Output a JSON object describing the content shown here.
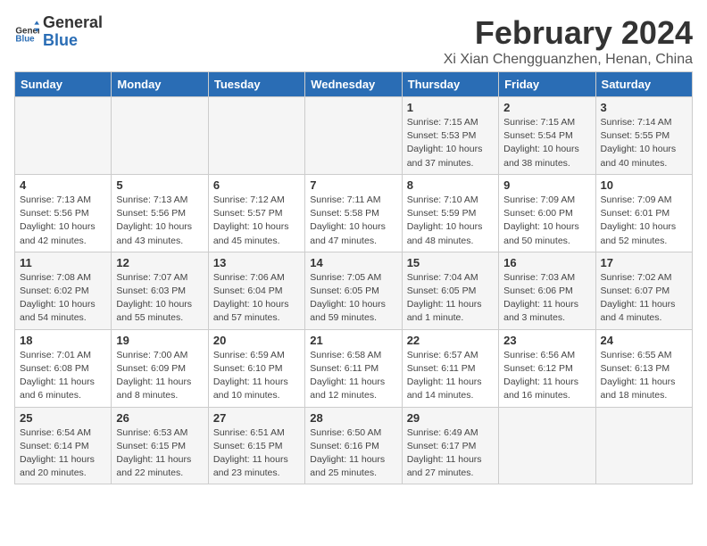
{
  "logo": {
    "name_part1": "General",
    "name_part2": "Blue"
  },
  "title": "February 2024",
  "subtitle": "Xi Xian Chengguanzhen, Henan, China",
  "days_of_week": [
    "Sunday",
    "Monday",
    "Tuesday",
    "Wednesday",
    "Thursday",
    "Friday",
    "Saturday"
  ],
  "weeks": [
    [
      {
        "day": "",
        "info": ""
      },
      {
        "day": "",
        "info": ""
      },
      {
        "day": "",
        "info": ""
      },
      {
        "day": "",
        "info": ""
      },
      {
        "day": "1",
        "info": "Sunrise: 7:15 AM\nSunset: 5:53 PM\nDaylight: 10 hours\nand 37 minutes."
      },
      {
        "day": "2",
        "info": "Sunrise: 7:15 AM\nSunset: 5:54 PM\nDaylight: 10 hours\nand 38 minutes."
      },
      {
        "day": "3",
        "info": "Sunrise: 7:14 AM\nSunset: 5:55 PM\nDaylight: 10 hours\nand 40 minutes."
      }
    ],
    [
      {
        "day": "4",
        "info": "Sunrise: 7:13 AM\nSunset: 5:56 PM\nDaylight: 10 hours\nand 42 minutes."
      },
      {
        "day": "5",
        "info": "Sunrise: 7:13 AM\nSunset: 5:56 PM\nDaylight: 10 hours\nand 43 minutes."
      },
      {
        "day": "6",
        "info": "Sunrise: 7:12 AM\nSunset: 5:57 PM\nDaylight: 10 hours\nand 45 minutes."
      },
      {
        "day": "7",
        "info": "Sunrise: 7:11 AM\nSunset: 5:58 PM\nDaylight: 10 hours\nand 47 minutes."
      },
      {
        "day": "8",
        "info": "Sunrise: 7:10 AM\nSunset: 5:59 PM\nDaylight: 10 hours\nand 48 minutes."
      },
      {
        "day": "9",
        "info": "Sunrise: 7:09 AM\nSunset: 6:00 PM\nDaylight: 10 hours\nand 50 minutes."
      },
      {
        "day": "10",
        "info": "Sunrise: 7:09 AM\nSunset: 6:01 PM\nDaylight: 10 hours\nand 52 minutes."
      }
    ],
    [
      {
        "day": "11",
        "info": "Sunrise: 7:08 AM\nSunset: 6:02 PM\nDaylight: 10 hours\nand 54 minutes."
      },
      {
        "day": "12",
        "info": "Sunrise: 7:07 AM\nSunset: 6:03 PM\nDaylight: 10 hours\nand 55 minutes."
      },
      {
        "day": "13",
        "info": "Sunrise: 7:06 AM\nSunset: 6:04 PM\nDaylight: 10 hours\nand 57 minutes."
      },
      {
        "day": "14",
        "info": "Sunrise: 7:05 AM\nSunset: 6:05 PM\nDaylight: 10 hours\nand 59 minutes."
      },
      {
        "day": "15",
        "info": "Sunrise: 7:04 AM\nSunset: 6:05 PM\nDaylight: 11 hours\nand 1 minute."
      },
      {
        "day": "16",
        "info": "Sunrise: 7:03 AM\nSunset: 6:06 PM\nDaylight: 11 hours\nand 3 minutes."
      },
      {
        "day": "17",
        "info": "Sunrise: 7:02 AM\nSunset: 6:07 PM\nDaylight: 11 hours\nand 4 minutes."
      }
    ],
    [
      {
        "day": "18",
        "info": "Sunrise: 7:01 AM\nSunset: 6:08 PM\nDaylight: 11 hours\nand 6 minutes."
      },
      {
        "day": "19",
        "info": "Sunrise: 7:00 AM\nSunset: 6:09 PM\nDaylight: 11 hours\nand 8 minutes."
      },
      {
        "day": "20",
        "info": "Sunrise: 6:59 AM\nSunset: 6:10 PM\nDaylight: 11 hours\nand 10 minutes."
      },
      {
        "day": "21",
        "info": "Sunrise: 6:58 AM\nSunset: 6:11 PM\nDaylight: 11 hours\nand 12 minutes."
      },
      {
        "day": "22",
        "info": "Sunrise: 6:57 AM\nSunset: 6:11 PM\nDaylight: 11 hours\nand 14 minutes."
      },
      {
        "day": "23",
        "info": "Sunrise: 6:56 AM\nSunset: 6:12 PM\nDaylight: 11 hours\nand 16 minutes."
      },
      {
        "day": "24",
        "info": "Sunrise: 6:55 AM\nSunset: 6:13 PM\nDaylight: 11 hours\nand 18 minutes."
      }
    ],
    [
      {
        "day": "25",
        "info": "Sunrise: 6:54 AM\nSunset: 6:14 PM\nDaylight: 11 hours\nand 20 minutes."
      },
      {
        "day": "26",
        "info": "Sunrise: 6:53 AM\nSunset: 6:15 PM\nDaylight: 11 hours\nand 22 minutes."
      },
      {
        "day": "27",
        "info": "Sunrise: 6:51 AM\nSunset: 6:15 PM\nDaylight: 11 hours\nand 23 minutes."
      },
      {
        "day": "28",
        "info": "Sunrise: 6:50 AM\nSunset: 6:16 PM\nDaylight: 11 hours\nand 25 minutes."
      },
      {
        "day": "29",
        "info": "Sunrise: 6:49 AM\nSunset: 6:17 PM\nDaylight: 11 hours\nand 27 minutes."
      },
      {
        "day": "",
        "info": ""
      },
      {
        "day": "",
        "info": ""
      }
    ]
  ]
}
